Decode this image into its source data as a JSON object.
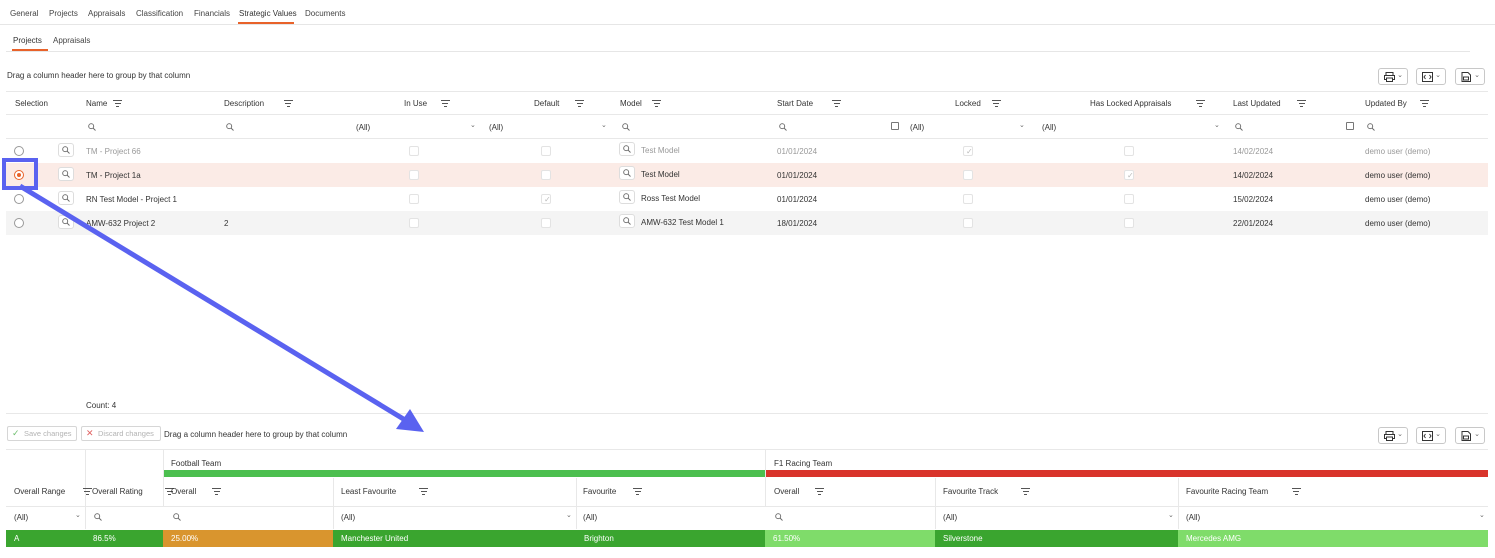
{
  "top_tabs": [
    "General",
    "Projects",
    "Appraisals",
    "Classification",
    "Financials",
    "Strategic Values",
    "Documents"
  ],
  "sub_tabs": [
    "Projects",
    "Appraisals"
  ],
  "grid1": {
    "drag_hint": "Drag a column header here to group by that column",
    "headers": [
      "Selection",
      "Name",
      "Description",
      "In Use",
      "Default",
      "Model",
      "Start Date",
      "Locked",
      "Has Locked Appraisals",
      "Last Updated",
      "Updated By"
    ],
    "filter_all": "(All)",
    "rows": [
      {
        "name": "TM - Project 66",
        "description": "",
        "in_use": false,
        "default": false,
        "model": "Test Model",
        "start_date": "01/01/2024",
        "locked": true,
        "has_locked": false,
        "last_updated": "14/02/2024",
        "updated_by": "demo user (demo)",
        "selected": false
      },
      {
        "name": "TM - Project 1a",
        "description": "",
        "in_use": false,
        "default": false,
        "model": "Test Model",
        "start_date": "01/01/2024",
        "locked": false,
        "has_locked": true,
        "last_updated": "14/02/2024",
        "updated_by": "demo user (demo)",
        "selected": true
      },
      {
        "name": "RN Test Model - Project 1",
        "description": "",
        "in_use": false,
        "default": true,
        "model": "Ross Test Model",
        "start_date": "01/01/2024",
        "locked": false,
        "has_locked": false,
        "last_updated": "15/02/2024",
        "updated_by": "demo user (demo)",
        "selected": false
      },
      {
        "name": "AMW-632 Project 2",
        "description": "2",
        "in_use": false,
        "default": false,
        "model": "AMW-632 Test Model 1",
        "start_date": "18/01/2024",
        "locked": false,
        "has_locked": false,
        "last_updated": "22/01/2024",
        "updated_by": "demo user (demo)",
        "selected": false
      }
    ],
    "count": "Count: 4"
  },
  "grid2": {
    "save_label": "Save changes",
    "discard_label": "Discard changes",
    "drag_hint": "Drag a column header here to group by that column",
    "bands": [
      "Football Team",
      "F1 Racing Team"
    ],
    "band_colors": [
      "#4cbf4f",
      "#d9342b"
    ],
    "headers": [
      "Overall Range",
      "Overall Rating",
      "Overall",
      "Least Favourite",
      "Favourite",
      "Overall",
      "Favourite Track",
      "Favourite Racing Team"
    ],
    "filter_all": "(All)",
    "row": [
      "A",
      "86.5%",
      "25.00%",
      "Manchester United",
      "Brighton",
      "61.50%",
      "Silverstone",
      "Mercedes AMG"
    ],
    "row_colors": [
      "#3aa52f",
      "#3aa52f",
      "#d9952e",
      "#3aa52f",
      "#3aa52f",
      "#7fdc6a",
      "#3aa52f",
      "#7fdc6a"
    ]
  },
  "annotation_color": "#5a62f0",
  "accent": "#e8622a"
}
